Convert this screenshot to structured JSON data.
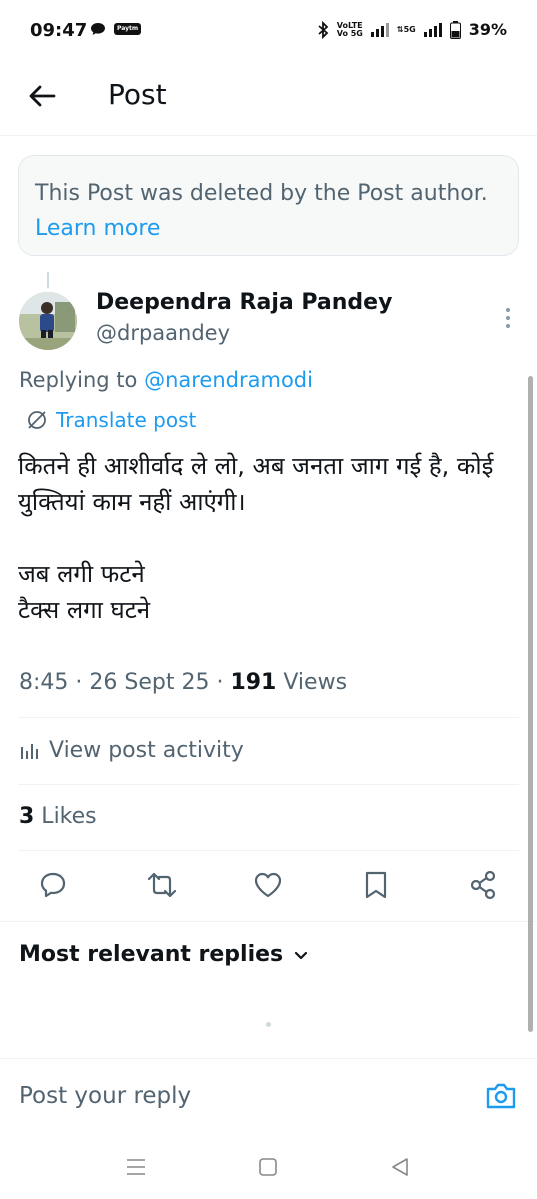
{
  "status_bar": {
    "time": "09:47",
    "paytm_label": "Paytm",
    "volte_line1": "VoLTE",
    "volte_line2": "Vo 5G",
    "network_label": "5G",
    "battery": "39%"
  },
  "header": {
    "title": "Post"
  },
  "deleted_notice": {
    "text": "This Post was deleted by the Post author. ",
    "link": "Learn more"
  },
  "post": {
    "author_name": "Deependra Raja Pandey",
    "author_handle": "@drpaandey",
    "replying_prefix": "Replying to ",
    "replying_mention": "@narendramodi",
    "translate_label": "Translate post",
    "text": "कितने ही आशीर्वाद ले लो, अब जनता जाग गई है, कोई युक्तियां काम नहीं आएंगी।\n\nजब लगी फटने\nटैक्स लगा घटने",
    "time_date": "8:45 · 26 Sept 25 · ",
    "views_count": "191",
    "views_label": " Views",
    "activity_label": "View post activity",
    "likes_count": "3",
    "likes_label": " Likes"
  },
  "actions": {
    "icons": [
      "reply-icon",
      "repost-icon",
      "like-icon",
      "bookmark-icon",
      "share-icon"
    ]
  },
  "replies": {
    "sort_label": "Most relevant replies"
  },
  "reply_bar": {
    "placeholder": "Post your reply"
  },
  "colors": {
    "accent": "#1d9bf0",
    "text_primary": "#0f1419",
    "text_secondary": "#536471"
  }
}
